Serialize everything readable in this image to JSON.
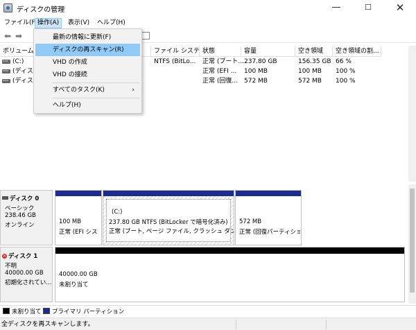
{
  "window": {
    "title": "ディスクの管理",
    "minimize": "—",
    "maximize": "☐",
    "close": "✕"
  },
  "menubar": [
    "ファイル(F)",
    "操作(A)",
    "表示(V)",
    "ヘルプ(H)"
  ],
  "dropdown": {
    "items": [
      {
        "label": "最新の情報に更新(F)"
      },
      {
        "label": "ディスクの再スキャン(R)"
      },
      {
        "label": "VHD の作成"
      },
      {
        "label": "VHD の接続"
      },
      {
        "label": "すべてのタスク(K)",
        "arrow": "›"
      },
      {
        "label": "ヘルプ(H)"
      }
    ]
  },
  "volumes": {
    "headers": [
      "ボリューム",
      "ファイル システム",
      "状態",
      "容量",
      "空き領域",
      "空き領域の割..."
    ],
    "rows": [
      {
        "volume": "(C:)",
        "fs": "NTFS (BitLo...",
        "status": "正常 (ブート...",
        "capacity": "237.80 GB",
        "free": "156.35 GB",
        "pct": "66 %"
      },
      {
        "volume": "(ディスク",
        "fs": "",
        "status": "正常 (EFI ...",
        "capacity": "100 MB",
        "free": "100 MB",
        "pct": "100 %"
      },
      {
        "volume": "(ディスク",
        "fs": "",
        "status": "正常 (回復...",
        "capacity": "572 MB",
        "free": "572 MB",
        "pct": "100 %"
      }
    ]
  },
  "disks": [
    {
      "name": "ディスク 0",
      "type": "ベーシック",
      "size": "238.46 GB",
      "state": "オンライン",
      "partitions": [
        {
          "size": "100 MB",
          "desc": "正常 (EFI シス"
        },
        {
          "label": "(C:)",
          "size": "237.80 GB NTFS (BitLocker で暗号化済み)",
          "desc": "正常 (ブート, ページ ファイル, クラッシュ ダンプ, ベー"
        },
        {
          "size": "572 MB",
          "desc": "正常 (回復パーティショ"
        }
      ]
    },
    {
      "name": "ディスク 1",
      "type": "不明",
      "size": "40000.00 GB",
      "state": "初期化されてい...",
      "partitions": [
        {
          "size": "40000.00 GB",
          "desc": "未割り当て"
        }
      ]
    }
  ],
  "legend": [
    "未割り当て",
    "プライマリ パーティション"
  ],
  "status": "全ディスクを再スキャンします。",
  "colors": {
    "primary_partition": "#1d2b8f",
    "unallocated": "#000000",
    "menu_highlight": "#91c9f7"
  }
}
